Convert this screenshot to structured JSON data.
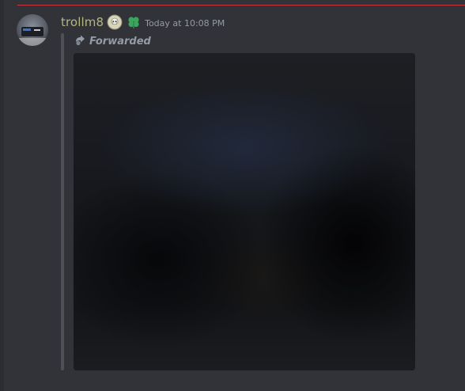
{
  "message": {
    "author": {
      "username": "trollm8",
      "username_color": "#b5b583",
      "avatar": "avatar-image",
      "badges": [
        "skull-badge-icon",
        "clover-badge-icon"
      ]
    },
    "timestamp": "Today at 10:08 PM",
    "forwarded": {
      "icon": "forward-icon",
      "label": "Forwarded"
    },
    "attachment": {
      "type": "image",
      "description": "dark blurred image"
    }
  },
  "theme": {
    "background": "#313338",
    "mention_divider": "#c7373d",
    "quote_bar": "#4e5058",
    "muted_text": "#949ba4",
    "badge_green": "#3ba55d"
  }
}
